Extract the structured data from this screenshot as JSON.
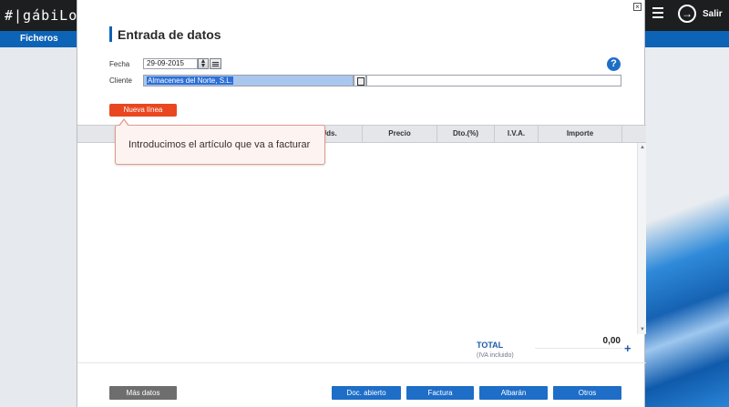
{
  "app": {
    "logo_text": "#|gábiLoS",
    "nav_item": "Ficheros",
    "exit_label": "Salir"
  },
  "modal": {
    "title": "Entrada de datos",
    "fecha_label": "Fecha",
    "fecha_value": "29-09-2015",
    "cliente_label": "Cliente",
    "cliente_value": "Almacenes del Norte, S.L.",
    "nueva_linea": "Nueva línea",
    "help": "?"
  },
  "table": {
    "columns": [
      "Uds.",
      "Precio",
      "Dto.(%)",
      "I.V.A.",
      "Importe"
    ]
  },
  "tooltip": {
    "text": "Introducimos el artículo que va a facturar"
  },
  "totals": {
    "label": "TOTAL",
    "sublabel": "(IVA incluido)",
    "value": "0,00"
  },
  "footer": {
    "mas_datos": "Más datos",
    "doc_abierto": "Doc. abierto",
    "factura": "Factura",
    "albaran": "Albarán",
    "otros": "Otros"
  },
  "colors": {
    "accent_blue": "#1e6ec8",
    "nueva_orange": "#e9471f",
    "topbar": "#1d1e20"
  }
}
